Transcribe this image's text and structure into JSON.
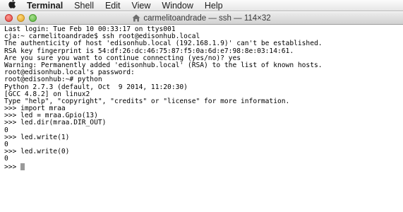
{
  "menubar": {
    "apple_icon": "apple-logo-icon",
    "items": [
      "Terminal",
      "Shell",
      "Edit",
      "View",
      "Window",
      "Help"
    ]
  },
  "window": {
    "title": "carmelitoandrade — ssh — 114×32",
    "title_icon": "home-folder-icon"
  },
  "terminal": {
    "lines": [
      "Last login: Tue Feb 10 00:33:17 on ttys001",
      "cja:~ carmelitoandrade$ ssh root@edisonhub.local",
      "The authenticity of host 'edisonhub.local (192.168.1.9)' can't be established.",
      "RSA key fingerprint is 54:df:26:dc:46:75:87:f5:0a:6d:e7:98:8e:03:14:61.",
      "Are you sure you want to continue connecting (yes/no)? yes",
      "Warning: Permanently added 'edisonhub.local' (RSA) to the list of known hosts.",
      "root@edisonhub.local's password:",
      "root@edisonhub:~# python",
      "Python 2.7.3 (default, Oct  9 2014, 11:20:30)",
      "[GCC 4.8.2] on linux2",
      "Type \"help\", \"copyright\", \"credits\" or \"license\" for more information.",
      ">>> import mraa",
      ">>> led = mraa.Gpio(13)",
      ">>> led.dir(mraa.DIR_OUT)",
      "0",
      ">>> led.write(1)",
      "0",
      ">>> led.write(0)",
      "0",
      ">>> "
    ],
    "cursor_color": "#9a9a9a"
  }
}
